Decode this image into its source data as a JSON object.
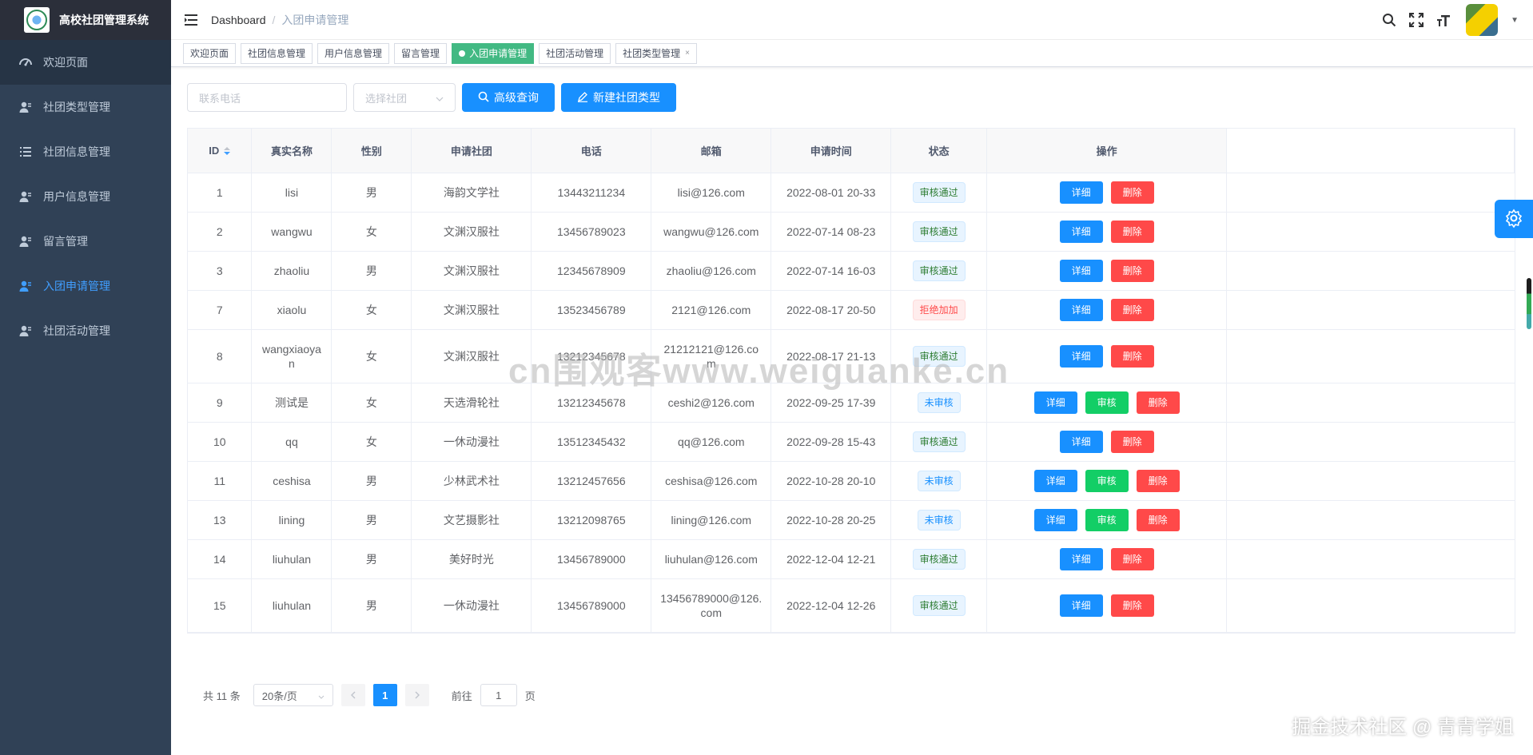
{
  "sidebar": {
    "title": "高校社团管理系统",
    "items": [
      {
        "label": "欢迎页面",
        "icon": "dashboard-icon"
      },
      {
        "label": "社团类型管理",
        "icon": "user-icon"
      },
      {
        "label": "社团信息管理",
        "icon": "list-icon"
      },
      {
        "label": "用户信息管理",
        "icon": "user-icon"
      },
      {
        "label": "留言管理",
        "icon": "user-icon"
      },
      {
        "label": "入团申请管理",
        "icon": "user-icon"
      },
      {
        "label": "社团活动管理",
        "icon": "user-icon"
      }
    ]
  },
  "navbar": {
    "home": "Dashboard",
    "separator": "/",
    "current": "入团申请管理"
  },
  "tags": [
    {
      "label": "欢迎页面"
    },
    {
      "label": "社团信息管理"
    },
    {
      "label": "用户信息管理"
    },
    {
      "label": "留言管理"
    },
    {
      "label": "入团申请管理"
    },
    {
      "label": "社团活动管理"
    },
    {
      "label": "社团类型管理"
    }
  ],
  "filter": {
    "phone_placeholder": "联系电话",
    "club_placeholder": "选择社团",
    "search_label": "高级查询",
    "add_label": "新建社团类型"
  },
  "table": {
    "headers": [
      "ID",
      "真实名称",
      "性别",
      "申请社团",
      "电话",
      "邮箱",
      "申请时间",
      "状态",
      "操作"
    ],
    "rows": [
      {
        "id": "1",
        "name": "lisi",
        "gender": "男",
        "club": "海韵文学社",
        "phone": "13443211234",
        "email": "lisi@126.com",
        "time": "2022-08-01 20-33",
        "status": "审核通过"
      },
      {
        "id": "2",
        "name": "wangwu",
        "gender": "女",
        "club": "文渊汉服社",
        "phone": "13456789023",
        "email": "wangwu@126.com",
        "time": "2022-07-14 08-23",
        "status": "审核通过"
      },
      {
        "id": "3",
        "name": "zhaoliu",
        "gender": "男",
        "club": "文渊汉服社",
        "phone": "12345678909",
        "email": "zhaoliu@126.com",
        "time": "2022-07-14 16-03",
        "status": "审核通过"
      },
      {
        "id": "7",
        "name": "xiaolu",
        "gender": "女",
        "club": "文渊汉服社",
        "phone": "13523456789",
        "email": "2121@126.com",
        "time": "2022-08-17 20-50",
        "status": "拒绝加加"
      },
      {
        "id": "8",
        "name": "wangxiaoyan",
        "gender": "女",
        "club": "文渊汉服社",
        "phone": "13212345678",
        "email": "21212121@126.com",
        "time": "2022-08-17 21-13",
        "status": "审核通过"
      },
      {
        "id": "9",
        "name": "测试是",
        "gender": "女",
        "club": "天选滑轮社",
        "phone": "13212345678",
        "email": "ceshi2@126.com",
        "time": "2022-09-25 17-39",
        "status": "未审核"
      },
      {
        "id": "10",
        "name": "qq",
        "gender": "女",
        "club": "一休动漫社",
        "phone": "13512345432",
        "email": "qq@126.com",
        "time": "2022-09-28 15-43",
        "status": "审核通过"
      },
      {
        "id": "11",
        "name": "ceshisa",
        "gender": "男",
        "club": "少林武术社",
        "phone": "13212457656",
        "email": "ceshisa@126.com",
        "time": "2022-10-28 20-10",
        "status": "未审核"
      },
      {
        "id": "13",
        "name": "lining",
        "gender": "男",
        "club": "文艺摄影社",
        "phone": "13212098765",
        "email": "lining@126.com",
        "time": "2022-10-28 20-25",
        "status": "未审核"
      },
      {
        "id": "14",
        "name": "liuhulan",
        "gender": "男",
        "club": "美好时光",
        "phone": "13456789000",
        "email": "liuhulan@126.com",
        "time": "2022-12-04 12-21",
        "status": "审核通过"
      },
      {
        "id": "15",
        "name": "liuhulan",
        "gender": "男",
        "club": "一休动漫社",
        "phone": "13456789000",
        "email": "13456789000@126.com",
        "time": "2022-12-04 12-26",
        "status": "审核通过"
      }
    ],
    "btn_detail": "详细",
    "btn_audit": "审核",
    "btn_delete": "删除"
  },
  "pagination": {
    "total": "共 11 条",
    "page_size": "20条/页",
    "current": "1",
    "goto_label": "前往",
    "goto_value": "1",
    "page_unit": "页"
  },
  "watermarks": {
    "center": "cn围观客www.weiguanke.cn",
    "bottom_right": "掘金技术社区 @ 青青学姐"
  }
}
